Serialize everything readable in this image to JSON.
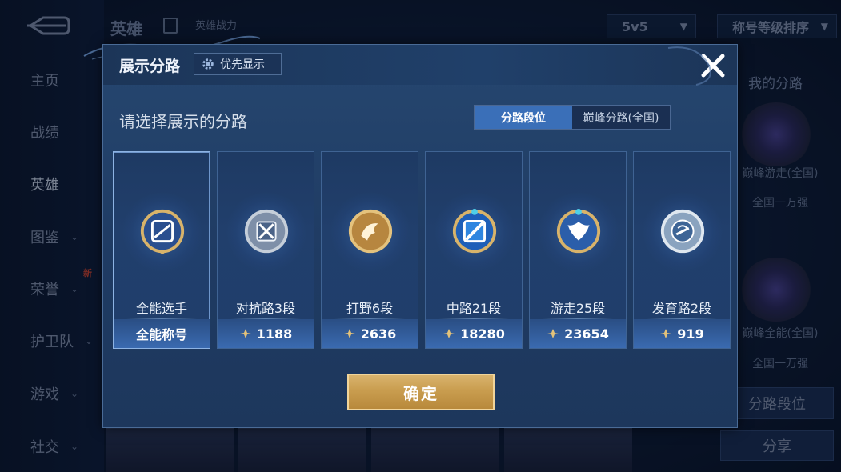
{
  "background": {
    "sidebar": [
      {
        "label": "主页",
        "chevron": false
      },
      {
        "label": "战绩",
        "chevron": false
      },
      {
        "label": "英雄",
        "chevron": false,
        "active": true
      },
      {
        "label": "图鉴",
        "chevron": true
      },
      {
        "label": "荣誉",
        "chevron": true
      },
      {
        "label": "护卫队",
        "chevron": true
      },
      {
        "label": "游戏",
        "chevron": true
      },
      {
        "label": "社交",
        "chevron": true
      }
    ],
    "new_badge": "新",
    "page_title": "英雄",
    "hero_power_label": "英雄战力",
    "mode_dropdown": "5v5",
    "sort_dropdown": "称号等级排序",
    "my_lanes_title": "我的分路",
    "right_labels": [
      "巅峰游走(全国)",
      "全国一万强",
      "巅峰全能(全国)",
      "全国一万强"
    ],
    "lane_rank_button": "分路段位",
    "share_button": "分享"
  },
  "modal": {
    "title": "展示分路",
    "priority_button": "优先显示",
    "subtitle": "请选择展示的分路",
    "tabs": [
      {
        "label": "分路段位",
        "active": true
      },
      {
        "label": "巅峰分路(全国)",
        "active": false
      }
    ],
    "cards": [
      {
        "label": "全能选手",
        "footer": "全能称号",
        "points": false,
        "emblem": "all-round-emblem-icon",
        "selected": true
      },
      {
        "label": "对抗路3段",
        "footer": "1188",
        "points": true,
        "emblem": "clash-lane-emblem-icon",
        "selected": false
      },
      {
        "label": "打野6段",
        "footer": "2636",
        "points": true,
        "emblem": "jungle-emblem-icon",
        "selected": false
      },
      {
        "label": "中路21段",
        "footer": "18280",
        "points": true,
        "emblem": "mid-lane-emblem-icon",
        "selected": false
      },
      {
        "label": "游走25段",
        "footer": "23654",
        "points": true,
        "emblem": "roam-emblem-icon",
        "selected": false
      },
      {
        "label": "发育路2段",
        "footer": "919",
        "points": true,
        "emblem": "farm-lane-emblem-icon",
        "selected": false
      }
    ],
    "confirm_button": "确定"
  },
  "colors": {
    "accent_blue": "#3a6fb8",
    "gold": "#c99d4f",
    "modal_bg": "#264770"
  }
}
